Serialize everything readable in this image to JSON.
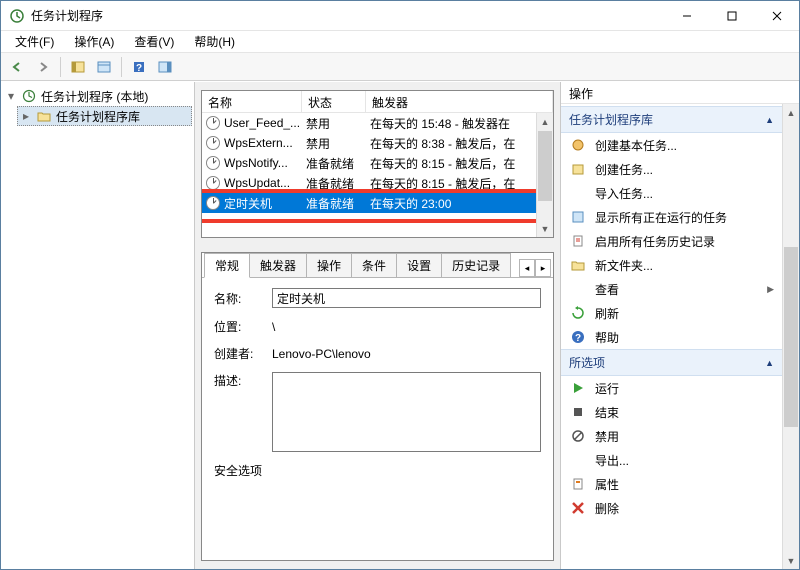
{
  "titlebar": {
    "title": "任务计划程序"
  },
  "menu": {
    "file": "文件(F)",
    "action": "操作(A)",
    "view": "查看(V)",
    "help": "帮助(H)"
  },
  "tree": {
    "root": "任务计划程序 (本地)",
    "lib": "任务计划程序库"
  },
  "tasklist": {
    "headers": {
      "name": "名称",
      "state": "状态",
      "trigger": "触发器"
    },
    "rows": [
      {
        "name": "User_Feed_...",
        "state": "禁用",
        "trigger": "在每天的 15:48 - 触发器在"
      },
      {
        "name": "WpsExtern...",
        "state": "禁用",
        "trigger": "在每天的 8:38 - 触发后，在"
      },
      {
        "name": "WpsNotify...",
        "state": "准备就绪",
        "trigger": "在每天的 8:15 - 触发后，在"
      },
      {
        "name": "WpsUpdat...",
        "state": "准备就绪",
        "trigger": "在每天的 8:15 - 触发后，在"
      },
      {
        "name": "定时关机",
        "state": "准备就绪",
        "trigger": "在每天的 23:00"
      }
    ]
  },
  "details": {
    "tabs": {
      "general": "常规",
      "triggers": "触发器",
      "actions": "操作",
      "conditions": "条件",
      "settings": "设置",
      "history": "历史记录"
    },
    "form": {
      "name_label": "名称:",
      "name_value": "定时关机",
      "location_label": "位置:",
      "location_value": "\\",
      "creator_label": "创建者:",
      "creator_value": "Lenovo-PC\\lenovo",
      "desc_label": "描述:",
      "desc_value": "",
      "security_label": "安全选项"
    }
  },
  "actions": {
    "header": "操作",
    "section1": "任务计划程序库",
    "items1": [
      "创建基本任务...",
      "创建任务...",
      "导入任务...",
      "显示所有正在运行的任务",
      "启用所有任务历史记录",
      "新文件夹...",
      "查看",
      "刷新",
      "帮助"
    ],
    "section2": "所选项",
    "items2": [
      "运行",
      "结束",
      "禁用",
      "导出...",
      "属性",
      "删除"
    ]
  }
}
